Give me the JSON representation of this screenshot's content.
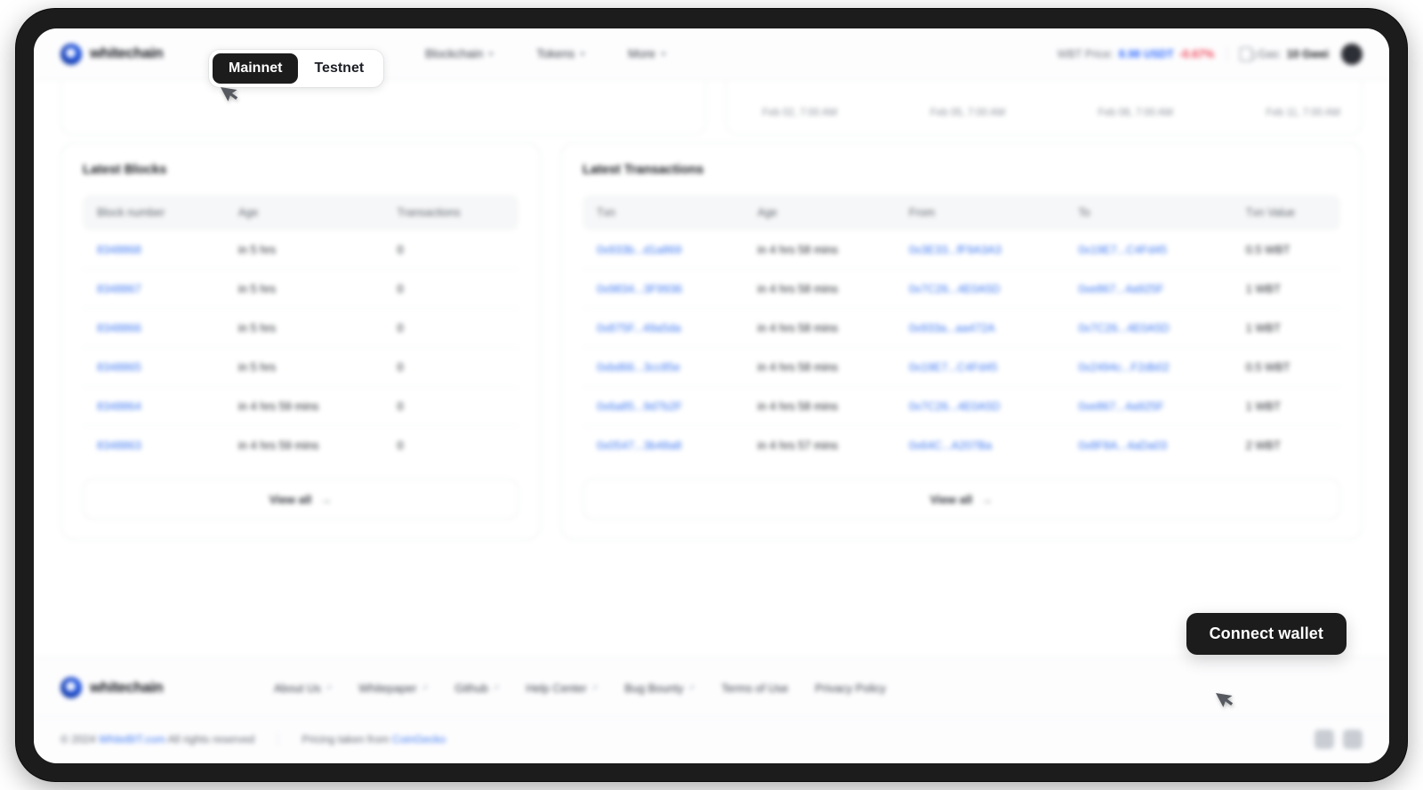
{
  "header": {
    "brand": "whitechain",
    "network_toggle": {
      "mainnet": "Mainnet",
      "testnet": "Testnet",
      "selected": "Mainnet"
    },
    "nav": [
      {
        "label": "Blockchain",
        "icon": "chevron-down-icon"
      },
      {
        "label": "Tokens",
        "icon": "chevron-down-icon"
      },
      {
        "label": "More",
        "icon": "chevron-down-icon"
      }
    ],
    "price_label": "WBT Price:",
    "price_value": "8.98 USDT",
    "price_change": "-0.67%",
    "gas_label": "Gas:",
    "gas_value": "10 Gwei",
    "gas_icon": "gas-icon",
    "avatar_icon": "avatar-icon"
  },
  "chart": {
    "x_ticks": [
      "Feb 02, 7:00 AM",
      "Feb 05, 7:00 AM",
      "Feb 08, 7:00 AM",
      "Feb 11, 7:00 AM"
    ]
  },
  "latest_blocks": {
    "title": "Latest Blocks",
    "columns": [
      "Block number",
      "Age",
      "Transactions"
    ],
    "rows": [
      {
        "block": "8348868",
        "age": "in 5 hrs",
        "txs": "0"
      },
      {
        "block": "8348867",
        "age": "in 5 hrs",
        "txs": "0"
      },
      {
        "block": "8348866",
        "age": "in 5 hrs",
        "txs": "0"
      },
      {
        "block": "8348865",
        "age": "in 5 hrs",
        "txs": "0"
      },
      {
        "block": "8348864",
        "age": "in 4 hrs 59 mins",
        "txs": "0"
      },
      {
        "block": "8348863",
        "age": "in 4 hrs 59 mins",
        "txs": "0"
      }
    ],
    "view_all": "View all",
    "view_all_icon": "arrow-right-icon"
  },
  "latest_transactions": {
    "title": "Latest Transactions",
    "columns": [
      "Txn",
      "Age",
      "From",
      "To",
      "Txn Value"
    ],
    "rows": [
      {
        "txn": "0x933b...d1a869",
        "age": "in 4 hrs 58 mins",
        "from": "0x3E33...fF9A3A3",
        "to": "0x19E7...C4Fd45",
        "value": "0.5 WBT"
      },
      {
        "txn": "0x9834...3F9936",
        "age": "in 4 hrs 58 mins",
        "from": "0x7C26...4E0A5D",
        "to": "0xe867...4a925F",
        "value": "1 WBT"
      },
      {
        "txn": "0x875F...49a5da",
        "age": "in 4 hrs 58 mins",
        "from": "0x933a...aa472A",
        "to": "0x7C26...4E0A5D",
        "value": "1 WBT"
      },
      {
        "txn": "0xbd66...3cc85e",
        "age": "in 4 hrs 58 mins",
        "from": "0x19E7...C4Fd45",
        "to": "0x2494c...F2db02",
        "value": "0.5 WBT"
      },
      {
        "txn": "0x6a85...9d7b2F",
        "age": "in 4 hrs 58 mins",
        "from": "0x7C26...4E0A5D",
        "to": "0xe867...4a925F",
        "value": "1 WBT"
      },
      {
        "txn": "0x0547...3b48a8",
        "age": "in 4 hrs 57 mins",
        "from": "0x64C...A207Ba",
        "to": "0x8F8A...4aDa03",
        "value": "2 WBT"
      }
    ],
    "view_all": "View all",
    "view_all_icon": "arrow-right-icon"
  },
  "footer": {
    "brand": "whitechain",
    "links": [
      {
        "label": "About Us",
        "external": true
      },
      {
        "label": "Whitepaper",
        "external": true
      },
      {
        "label": "Github",
        "external": true
      },
      {
        "label": "Help Center",
        "external": true
      },
      {
        "label": "Bug Bounty",
        "external": true
      },
      {
        "label": "Terms of Use",
        "external": false
      },
      {
        "label": "Privacy Policy",
        "external": false
      }
    ],
    "copyright_prefix": "© 2024",
    "copyright_link": "WhiteBIT.com",
    "copyright_suffix": "All rights reserved",
    "pricing_prefix": "Pricing taken from",
    "pricing_link": "CoinGecko",
    "app_badges": [
      "app-store-badge-icon",
      "google-play-badge-icon"
    ]
  },
  "overlay": {
    "connect_wallet": "Connect wallet",
    "cursor_icon": "mouse-pointer-icon"
  },
  "colors": {
    "accent_link": "#3a75f0",
    "price_up": "#2f6bff",
    "price_down": "#ef3d52",
    "dark": "#1c1c1c"
  }
}
